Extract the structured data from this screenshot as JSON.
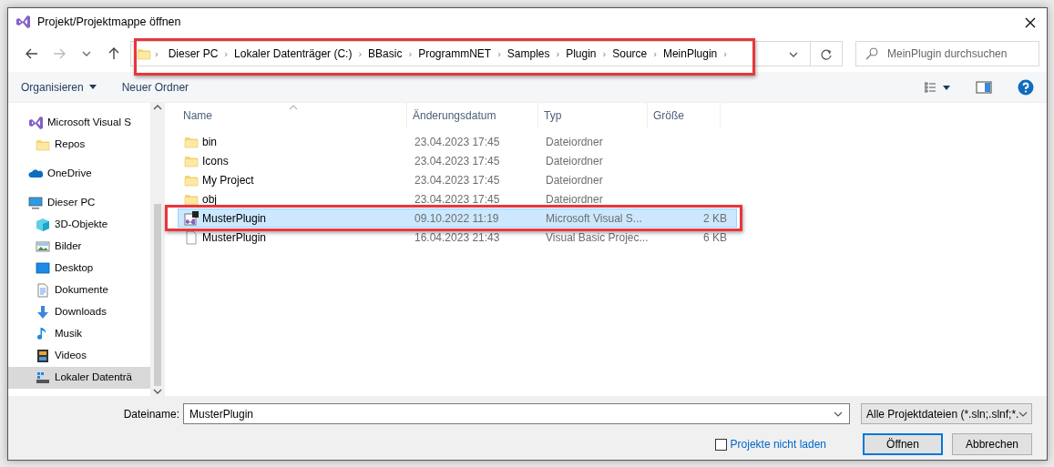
{
  "window": {
    "title": "Projekt/Projektmappe öffnen"
  },
  "nav": {
    "highlighted": true,
    "separator": "›",
    "path": [
      "Dieser PC",
      "Lokaler Datenträger (C:)",
      "BBasic",
      "ProgrammNET",
      "Samples",
      "Plugin",
      "Source",
      "MeinPlugin"
    ],
    "search": {
      "placeholder": "MeinPlugin durchsuchen"
    }
  },
  "toolbar": {
    "items": [
      {
        "label": "Organisieren",
        "kind": "menu"
      },
      {
        "label": "Neuer Ordner",
        "kind": "button"
      }
    ]
  },
  "sidebar": {
    "items": [
      {
        "label": "Microsoft Visual S",
        "kind": "vs",
        "selected": false,
        "children": [
          {
            "label": "Repos",
            "kind": "folder",
            "selected": false
          }
        ]
      },
      {
        "label": "OneDrive",
        "kind": "cloud",
        "selected": false
      },
      {
        "label": "Dieser PC",
        "kind": "pc",
        "selected": false,
        "children": [
          {
            "label": "3D-Objekte",
            "kind": "cube",
            "selected": false
          },
          {
            "label": "Bilder",
            "kind": "pictures",
            "selected": false
          },
          {
            "label": "Desktop",
            "kind": "desktop",
            "selected": false
          },
          {
            "label": "Dokumente",
            "kind": "document",
            "selected": false
          },
          {
            "label": "Downloads",
            "kind": "download",
            "selected": false
          },
          {
            "label": "Musik",
            "kind": "music",
            "selected": false
          },
          {
            "label": "Videos",
            "kind": "video",
            "selected": false
          },
          {
            "label": "Lokaler Datenträ",
            "kind": "drive",
            "selected": true
          }
        ]
      }
    ]
  },
  "files": {
    "columns": [
      "Name",
      "Änderungsdatum",
      "Typ",
      "Größe"
    ],
    "rows": [
      {
        "name": "bin",
        "date": "23.04.2023 17:45",
        "type": "Dateiordner",
        "kind": "folder",
        "selected": false,
        "highlighted": false
      },
      {
        "name": "Icons",
        "date": "23.04.2023 17:45",
        "type": "Dateiordner",
        "kind": "folder",
        "selected": false,
        "highlighted": false
      },
      {
        "name": "My Project",
        "date": "23.04.2023 17:45",
        "type": "Dateiordner",
        "kind": "folder",
        "selected": false,
        "highlighted": false
      },
      {
        "name": "obj",
        "date": "23.04.2023 17:45",
        "type": "Dateiordner",
        "kind": "folder",
        "selected": false,
        "highlighted": false
      },
      {
        "name": "MusterPlugin",
        "date": "09.10.2022 11:19",
        "type": "Microsoft Visual S...",
        "size": "2 KB",
        "kind": "solution",
        "selected": true,
        "highlighted": true
      },
      {
        "name": "MusterPlugin",
        "date": "16.04.2023 21:43",
        "type": "Visual Basic Projec...",
        "size": "6 KB",
        "kind": "file",
        "selected": false,
        "highlighted": false
      }
    ]
  },
  "footer": {
    "filename_label": "Dateiname:",
    "filename": "MusterPlugin",
    "filter": "Alle Projektdateien (*.sln;.slnf;*.",
    "checkbox": {
      "label": "Projekte nicht laden",
      "checked": false
    },
    "buttons": [
      {
        "label": "Öffnen",
        "default": true
      },
      {
        "label": "Abbrechen",
        "default": false
      }
    ]
  }
}
